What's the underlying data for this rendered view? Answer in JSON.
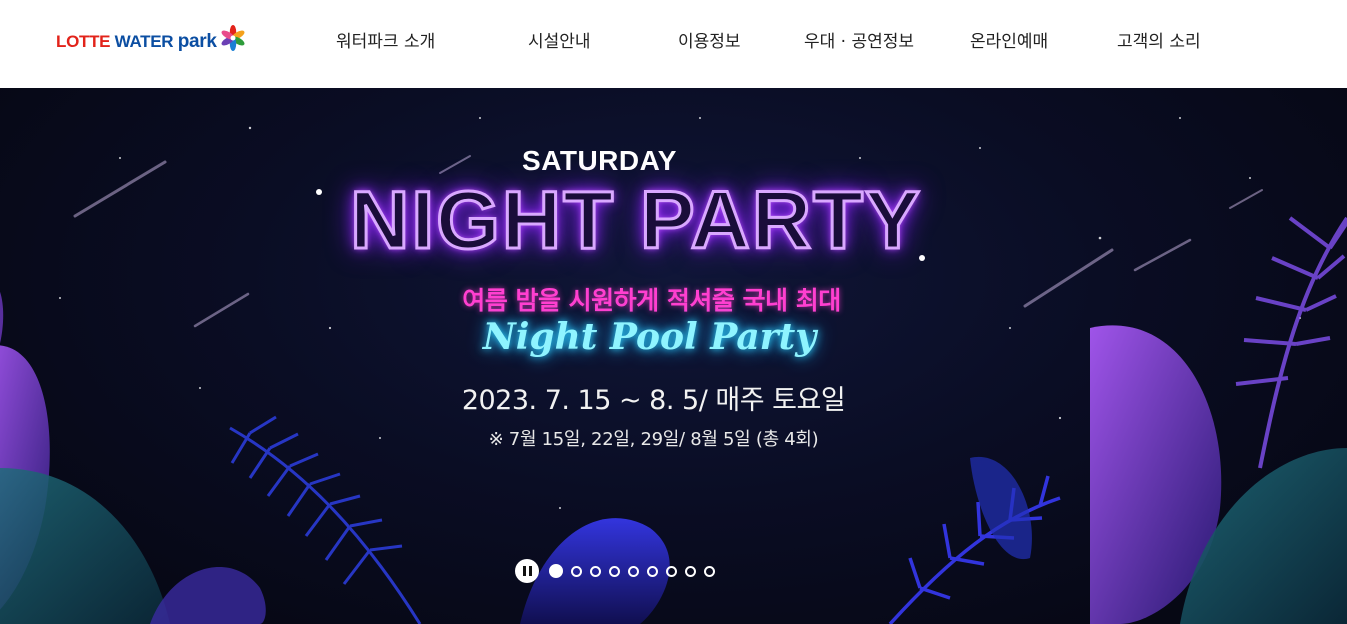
{
  "header": {
    "logo": {
      "part1": "LOTTE ",
      "part2": "WATER ",
      "part3": "park"
    },
    "nav": [
      {
        "label": "워터파크 소개"
      },
      {
        "label": "시설안내"
      },
      {
        "label": "이용정보"
      },
      {
        "label": "우대 · 공연정보"
      },
      {
        "label": "온라인예매"
      },
      {
        "label": "고객의 소리"
      }
    ]
  },
  "banner": {
    "eyebrow": "SATURDAY",
    "headline": "NIGHT PARTY",
    "tagline_kr": "여름 밤을 시원하게 적셔줄 국내 최대",
    "tagline_en": "Night Pool Party",
    "date": "2023. 7. 15 ~ 8. 5/ 매주 토요일",
    "note": "※ 7월 15일, 22일, 29일/  8월 5일 (총 4회)"
  },
  "slider": {
    "total": 9,
    "active_index": 1,
    "paused": false
  },
  "colors": {
    "brand_red": "#e2231a",
    "brand_blue": "#0b4ea2",
    "neon_purple": "#c45cff",
    "neon_pink": "#ff3fd0",
    "neon_cyan": "#8ff4ff"
  }
}
